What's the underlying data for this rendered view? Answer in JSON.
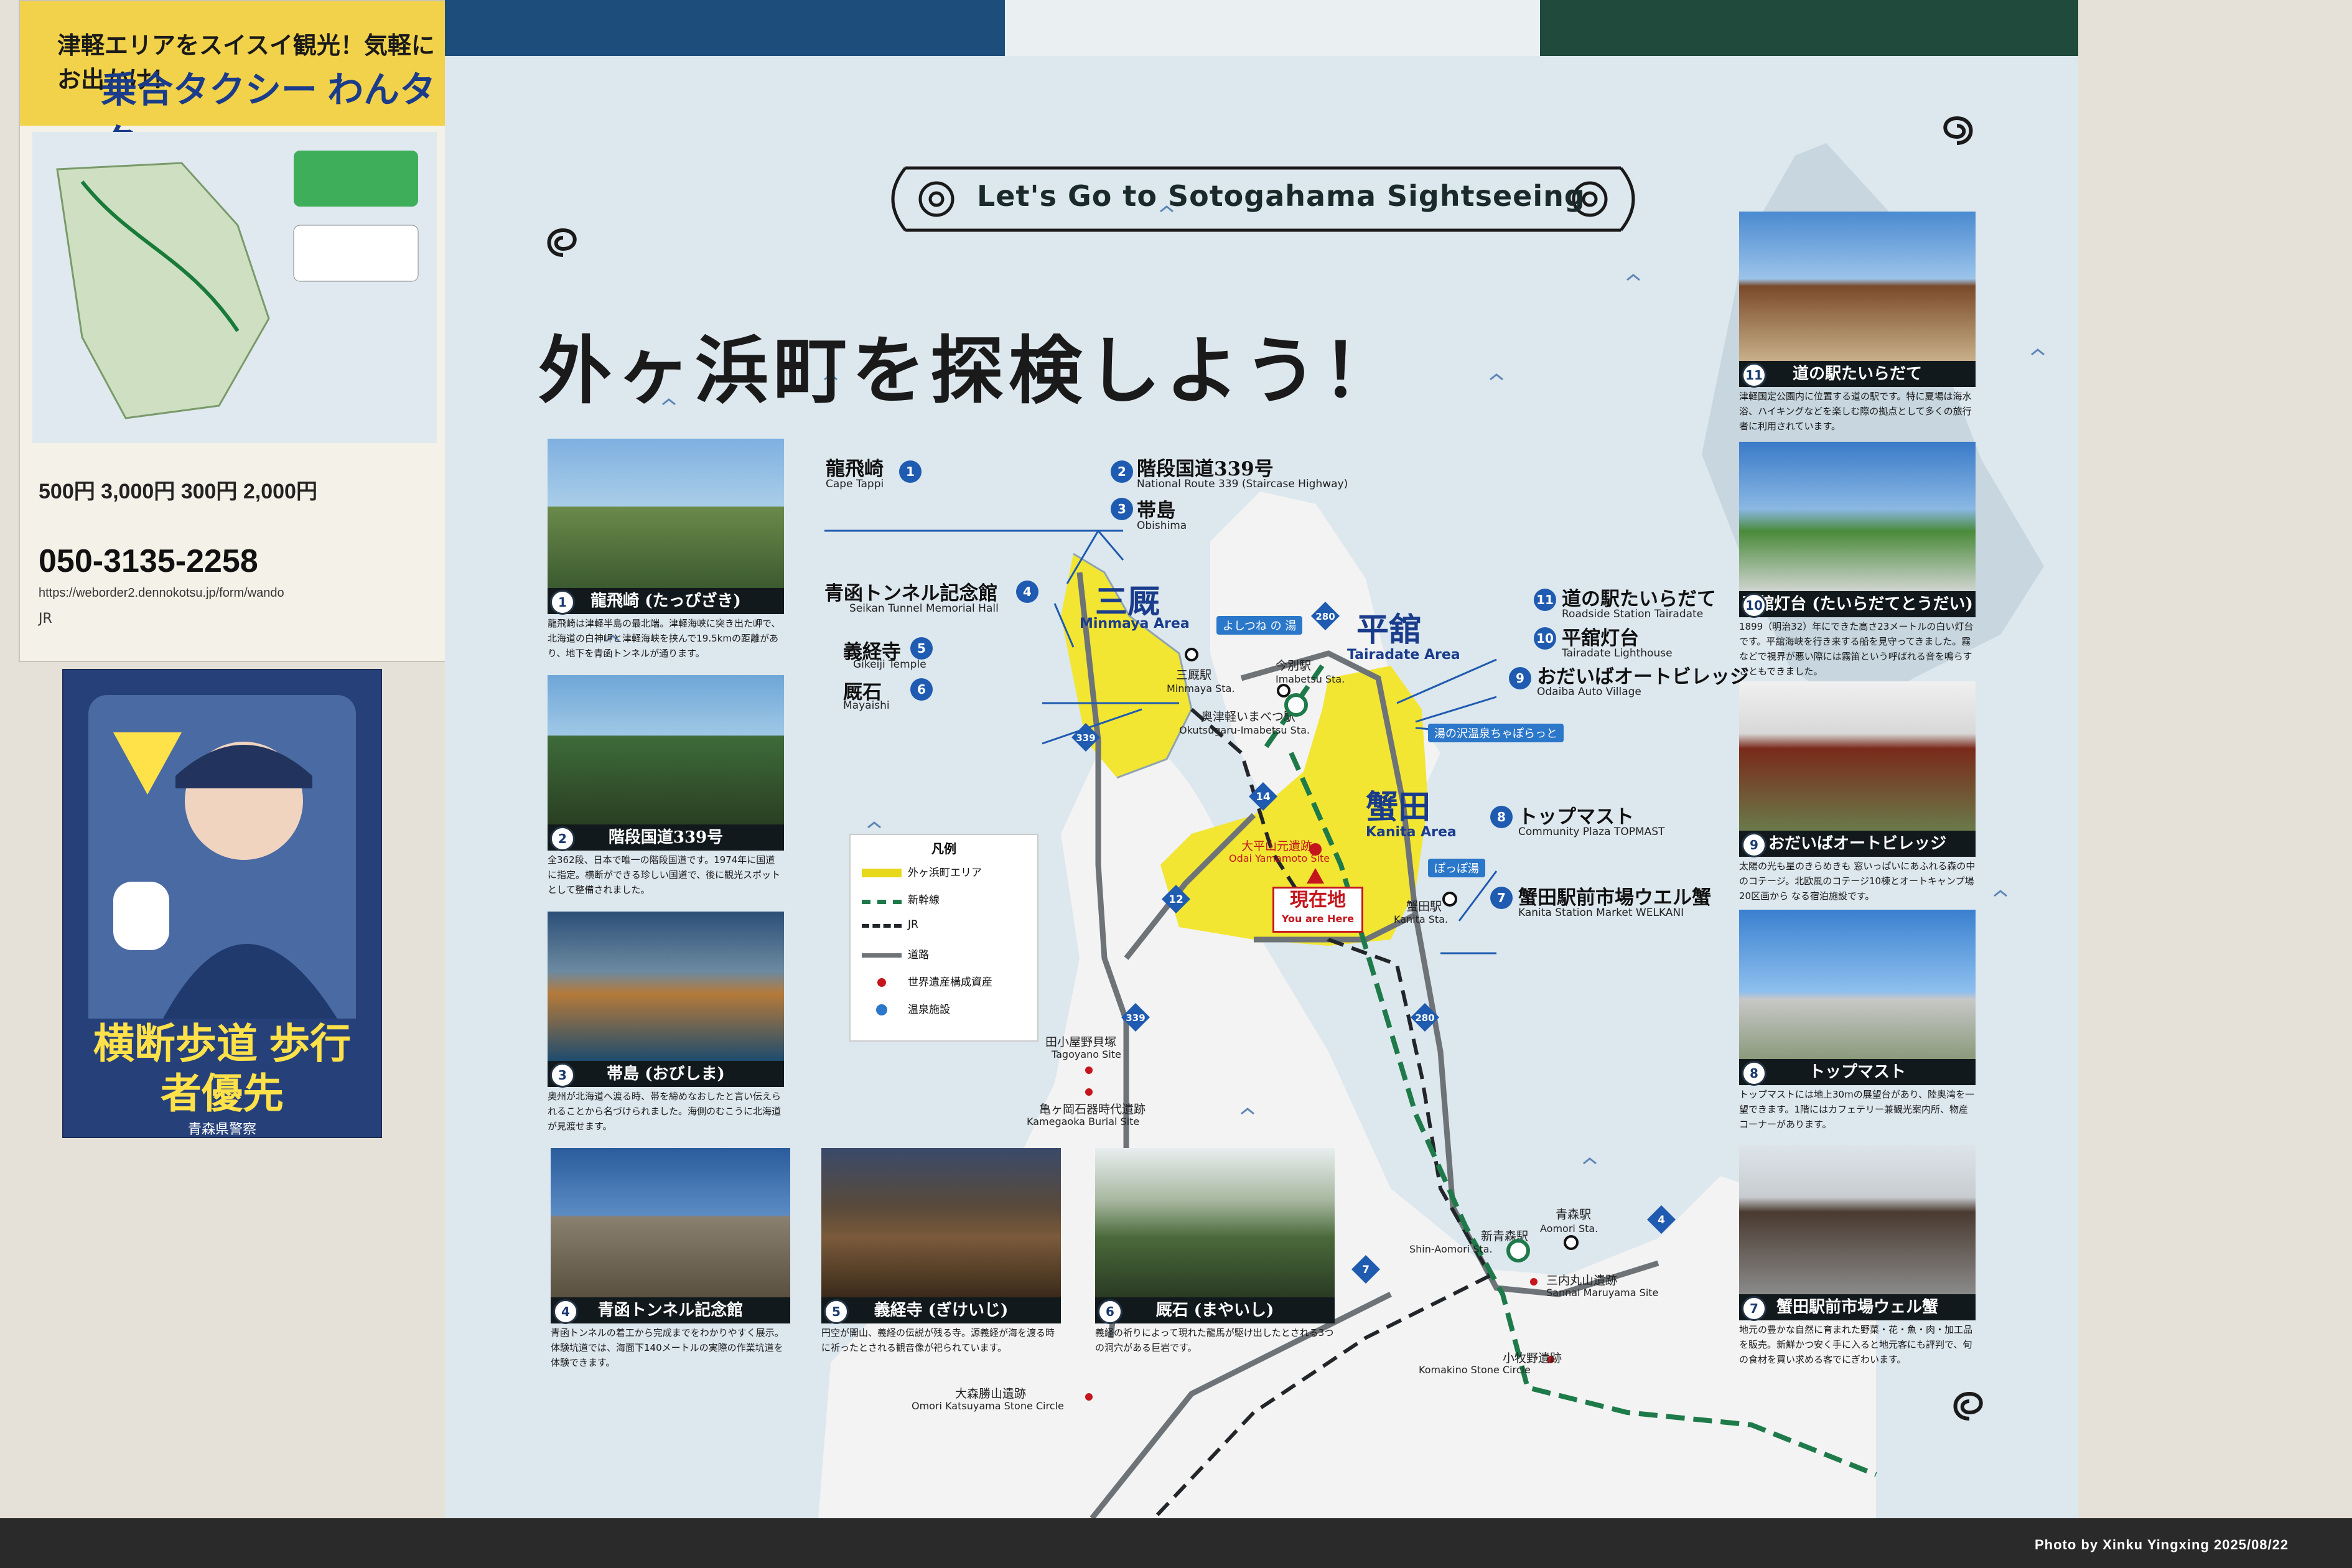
{
  "side_posters": {
    "taxi": {
      "headline": "津軽エリアをスイスイ観光！気軽にお出かけ！",
      "name": "乗合タクシー わんタク",
      "fares": "500円  3,000円  300円  2,000円",
      "phone": "050-3135-2258",
      "url": "https://weborder2.dennokotsu.jp/form/wando",
      "footer": "JR"
    },
    "police": {
      "slogan": "横断歩道 歩行者優先",
      "org": "青森県警察"
    }
  },
  "board": {
    "title_en": "Let's Go to Sotogahama Sightseeing",
    "title_jp": "外ヶ浜町を探検しよう！"
  },
  "cards": [
    {
      "num": "1",
      "name": "龍飛崎 (たっぴざき)",
      "desc": "龍飛崎は津軽半島の最北端。津軽海峡に突き出た岬で、北海道の白神岬と津軽海峡を挟んで19.5kmの距離があり、地下を青函トンネルが通ります。"
    },
    {
      "num": "2",
      "name": "階段国道339号",
      "desc": "全362段、日本で唯一の階段国道です。1974年に国道に指定。横断ができる珍しい国道で、後に観光スポットとして整備されました。"
    },
    {
      "num": "3",
      "name": "帯島 (おびしま)",
      "desc": "奥州が北海道へ渡る時、帯を締めなおしたと言い伝えられることから名づけられました。海側のむこうに北海道が見渡せます。"
    },
    {
      "num": "4",
      "name": "青函トンネル記念館",
      "desc": "青函トンネルの着工から完成までをわかりやすく展示。体験坑道では、海面下140メートルの実際の作業坑道を体験できます。"
    },
    {
      "num": "5",
      "name": "義経寺 (ぎけいじ)",
      "desc": "円空が開山、義経の伝説が残る寺。源義経が海を渡る時に祈ったとされる観音像が祀られています。"
    },
    {
      "num": "6",
      "name": "厩石 (まやいし)",
      "desc": "義経の祈りによって現れた龍馬が駆け出したとされる3つの洞穴がある巨岩です。"
    },
    {
      "num": "7",
      "name": "蟹田駅前市場ウェル蟹",
      "desc": "地元の豊かな自然に育まれた野菜・花・魚・肉・加工品を販売。新鮮かつ安く手に入ると地元客にも評判で、旬の食材を買い求める客でにぎわいます。"
    },
    {
      "num": "8",
      "name": "トップマスト",
      "desc": "トップマストには地上30mの展望台があり、陸奥湾を一望できます。1階にはカフェテリー兼観光案内所、物産コーナーがあります。"
    },
    {
      "num": "9",
      "name": "おだいばオートビレッジ",
      "desc": "太陽の光も星のきらめきも 窓いっぱいにあふれる森の中のコテージ。北欧風のコテージ10棟とオートキャンプ場20区画から なる宿泊施設です。"
    },
    {
      "num": "10",
      "name": "平舘灯台 (たいらだてとうだい)",
      "desc": "1899（明治32）年にできた高さ23メートルの白い灯台です。平舘海峡を行き来する船を見守ってきました。霧などで視界が悪い際には霧笛という呼ばれる音を鳴らすこともできました。"
    },
    {
      "num": "11",
      "name": "道の駅たいらだて",
      "desc": "津軽国定公園内に位置する道の駅です。特に夏場は海水浴、ハイキングなどを楽しむ際の拠点として多くの旅行者に利用されています。"
    }
  ],
  "map": {
    "places": [
      {
        "n": "1",
        "jp": "龍飛崎",
        "en": "Cape Tappi"
      },
      {
        "n": "2",
        "jp": "階段国道339号",
        "en": "National Route 339 (Staircase Highway)"
      },
      {
        "n": "3",
        "jp": "帯島",
        "en": "Obishima"
      },
      {
        "n": "4",
        "jp": "青函トンネル記念館",
        "en": "Seikan Tunnel Memorial Hall"
      },
      {
        "n": "5",
        "jp": "義経寺",
        "en": "Gikeiji Temple"
      },
      {
        "n": "6",
        "jp": "厩石",
        "en": "Mayaishi"
      },
      {
        "n": "7",
        "jp": "蟹田駅前市場ウエル蟹",
        "en": "Kanita Station Market WELKANI"
      },
      {
        "n": "8",
        "jp": "トップマスト",
        "en": "Community Plaza TOPMAST"
      },
      {
        "n": "9",
        "jp": "おだいばオートビレッジ",
        "en": "Odaiba Auto Village"
      },
      {
        "n": "10",
        "jp": "平舘灯台",
        "en": "Tairadate Lighthouse"
      },
      {
        "n": "11",
        "jp": "道の駅たいらだて",
        "en": "Roadside Station Tairadate"
      }
    ],
    "areas": [
      {
        "jp": "三厩",
        "en": "Minmaya Area"
      },
      {
        "jp": "平舘",
        "en": "Tairadate Area"
      },
      {
        "jp": "蟹田",
        "en": "Kanita Area"
      }
    ],
    "spas": [
      "よしつね の 湯",
      "湯の沢温泉ちゃぽらっと",
      "ぽっぽ湯"
    ],
    "stations": {
      "minmaya": {
        "jp": "三厩駅",
        "en": "Minmaya Sta."
      },
      "imabetsu": {
        "jp": "今別駅",
        "en": "Imabetsu Sta."
      },
      "okutsugaru": {
        "jp": "奥津軽いまべつ駅",
        "en": "Okutsugaru-Imabetsu Sta."
      },
      "kanita": {
        "jp": "蟹田駅",
        "en": "Kanita Sta."
      },
      "aomori": {
        "jp": "青森駅",
        "en": "Aomori Sta."
      },
      "shinaomori": {
        "jp": "新青森駅",
        "en": "Shin-Aomori Sta."
      }
    },
    "sites": {
      "odai": {
        "jp": "大平山元遺跡",
        "en": "Odai Yamamoto Site"
      },
      "tagoyano": {
        "jp": "田小屋野貝塚",
        "en": "Tagoyano Site"
      },
      "kamegaoka": {
        "jp": "亀ヶ岡石器時代遺跡",
        "en": "Kamegaoka Burial Site"
      },
      "sannai": {
        "jp": "三内丸山遺跡",
        "en": "Sannai Maruyama Site"
      },
      "komakino": {
        "jp": "小牧野遺跡",
        "en": "Komakino Stone Circle"
      },
      "omori": {
        "jp": "大森勝山遺跡",
        "en": "Omori Katsuyama Stone Circle"
      }
    },
    "routes": [
      "339",
      "280",
      "14",
      "12",
      "339",
      "280",
      "7",
      "4"
    ],
    "here": {
      "jp": "現在地",
      "en": "You are Here"
    },
    "legend": {
      "title": "凡例",
      "items": [
        "外ヶ浜町エリア",
        "新幹線",
        "JR",
        "道路",
        "世界遺産構成資産",
        "温泉施設"
      ]
    }
  },
  "credit": "Photo by Xinku Yingxing  2025/08/22",
  "colors": {
    "sea": "#dfe8ee",
    "land": "#f4f4f2",
    "area": "#f2e633",
    "badge": "#1f5bb0",
    "red": "#c4161c"
  }
}
